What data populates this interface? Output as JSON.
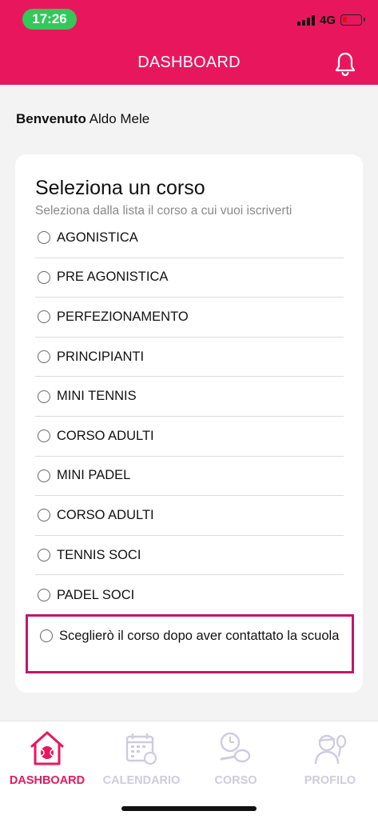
{
  "status_bar": {
    "time": "17:26",
    "network": "4G"
  },
  "header": {
    "title": "DASHBOARD"
  },
  "welcome": {
    "greeting": "Benvenuto",
    "name": "Aldo Mele"
  },
  "course_select": {
    "title": "Seleziona un corso",
    "subtitle": "Seleziona dalla lista il corso a cui vuoi iscriverti",
    "options": [
      "AGONISTICA",
      "PRE AGONISTICA",
      "PERFEZIONAMENTO",
      "PRINCIPIANTI",
      "MINI TENNIS",
      "CORSO ADULTI",
      "MINI PADEL",
      "CORSO ADULTI",
      "TENNIS SOCI",
      "PADEL SOCI"
    ],
    "later_option": "Sceglierò il corso dopo aver contattato la scuola"
  },
  "tabs": [
    {
      "label": "DASHBOARD",
      "icon": "home-ball-icon",
      "active": true
    },
    {
      "label": "CALENDARIO",
      "icon": "calendar-icon",
      "active": false
    },
    {
      "label": "CORSO",
      "icon": "course-racket-icon",
      "active": false
    },
    {
      "label": "PROFILO",
      "icon": "profile-player-icon",
      "active": false
    }
  ],
  "colors": {
    "brand": "#e8175d",
    "highlight_border": "#c2166c",
    "inactive_tab": "#cfcbe0"
  }
}
